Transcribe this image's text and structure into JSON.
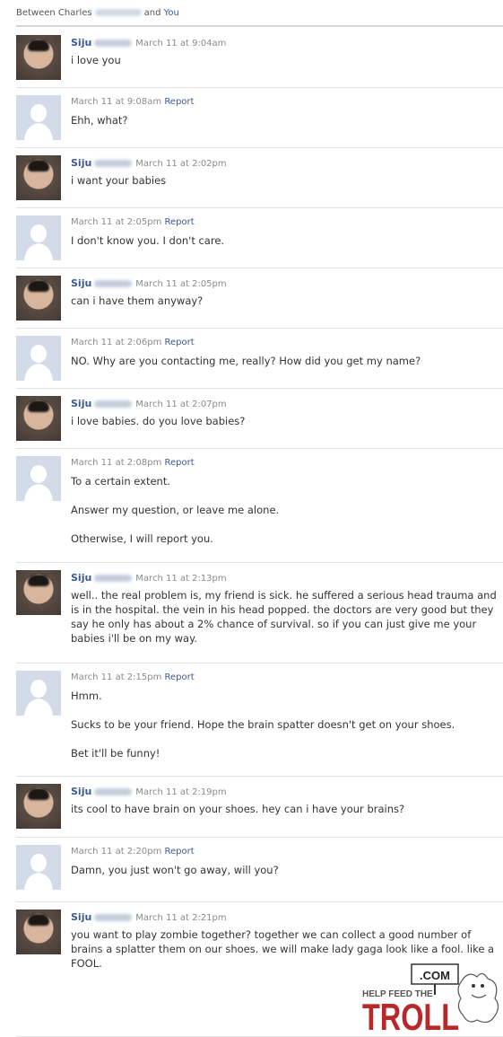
{
  "header": {
    "prefix": "Between Charles",
    "middle": "and",
    "you": "You"
  },
  "messages": [
    {
      "sender": "Siju",
      "time": "March 11 at 9:04am",
      "paragraphs": [
        "i love you"
      ]
    },
    {
      "sender": "",
      "time": "March 11 at 9:08am",
      "report": "Report",
      "paragraphs": [
        "Ehh, what?"
      ]
    },
    {
      "sender": "Siju",
      "time": "March 11 at 2:02pm",
      "paragraphs": [
        "i want your babies"
      ]
    },
    {
      "sender": "",
      "time": "March 11 at 2:05pm",
      "report": "Report",
      "paragraphs": [
        "I don't know you. I don't care."
      ]
    },
    {
      "sender": "Siju",
      "time": "March 11 at 2:05pm",
      "paragraphs": [
        "can i have them anyway?"
      ]
    },
    {
      "sender": "",
      "time": "March 11 at 2:06pm",
      "report": "Report",
      "paragraphs": [
        "NO. Why are you contacting me, really? How did you get my name?"
      ]
    },
    {
      "sender": "Siju",
      "time": "March 11 at 2:07pm",
      "paragraphs": [
        "i love babies. do you love babies?"
      ]
    },
    {
      "sender": "",
      "time": "March 11 at 2:08pm",
      "report": "Report",
      "paragraphs": [
        "To a certain extent.",
        "Answer my question, or leave me alone.",
        "Otherwise, I will report you."
      ]
    },
    {
      "sender": "Siju",
      "time": "March 11 at 2:13pm",
      "paragraphs": [
        "well.. the real problem is, my friend is sick. he suffered a serious head trauma and is in the hospital. the vein in his head popped. the doctors are very good but they say he only has about a 2% chance of survival. so if you can just give me your babies i'll be on my way."
      ]
    },
    {
      "sender": "",
      "time": "March 11 at 2:15pm",
      "report": "Report",
      "paragraphs": [
        "Hmm.",
        "Sucks to be your friend. Hope the brain spatter doesn't get on your shoes.",
        "Bet it'll be funny!"
      ]
    },
    {
      "sender": "Siju",
      "time": "March 11 at 2:19pm",
      "paragraphs": [
        "its cool to have brain on your shoes. hey can i have your brains?"
      ]
    },
    {
      "sender": "",
      "time": "March 11 at 2:20pm",
      "report": "Report",
      "paragraphs": [
        "Damn, you just won't go away, will you?"
      ]
    },
    {
      "sender": "Siju",
      "time": "March 11 at 2:21pm",
      "paragraphs": [
        "you want to play zombie together? together we can collect a good number of brains a splatter them on our shoes. we will make lady gaga look like a fool. like a FOOL."
      ]
    }
  ],
  "watermark": {
    "sign": ".COM",
    "tagline": "HELP FEED THE",
    "word": "TROLL"
  },
  "colors": {
    "link": "#3b5998",
    "troll_red": "#b8282a"
  }
}
